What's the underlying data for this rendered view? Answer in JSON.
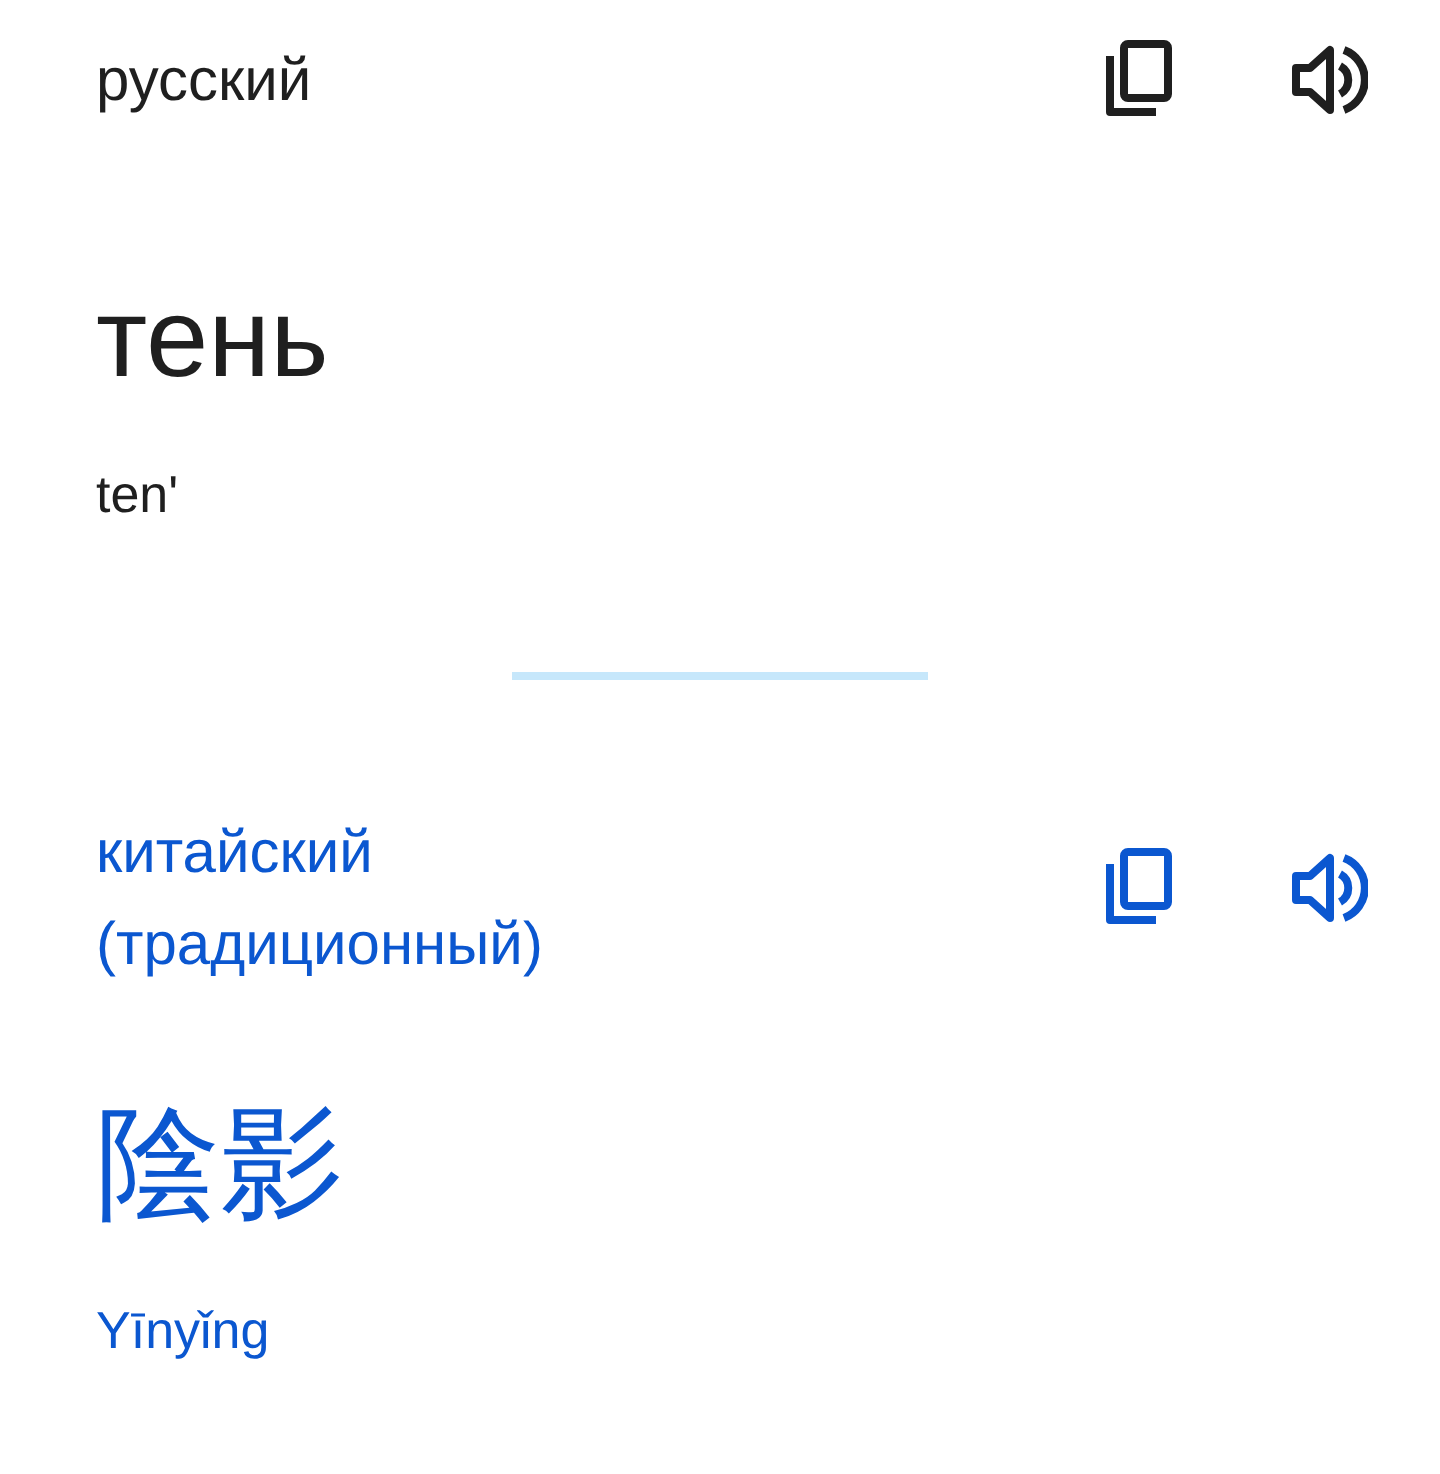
{
  "source": {
    "language": "русский",
    "text": "тень",
    "transliteration": "ten'"
  },
  "target": {
    "language": "китайский (традиционный)",
    "text": "陰影",
    "transliteration": "Yīnyǐng"
  }
}
